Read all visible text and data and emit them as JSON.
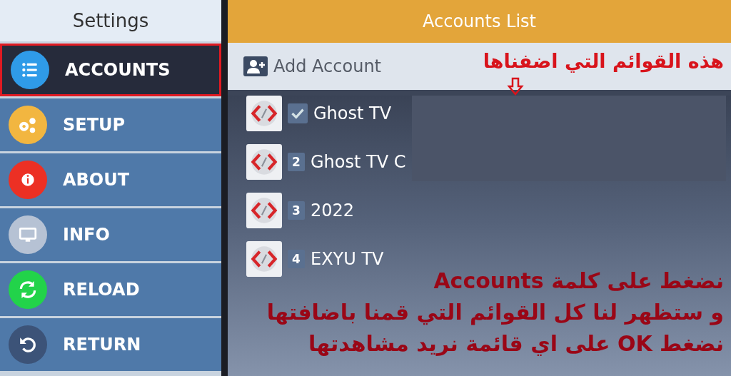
{
  "sidebar": {
    "title": "Settings",
    "items": [
      {
        "label": "ACCOUNTS",
        "selected": true,
        "color": "#2f9be8"
      },
      {
        "label": "SETUP",
        "selected": false,
        "color": "#f2b640"
      },
      {
        "label": "ABOUT",
        "selected": false,
        "color": "#ec3024"
      },
      {
        "label": "INFO",
        "selected": false,
        "color": "#b6c2d4"
      },
      {
        "label": "RELOAD",
        "selected": false,
        "color": "#22d34a"
      },
      {
        "label": "RETURN",
        "selected": false,
        "color": "#3c5378"
      }
    ]
  },
  "main": {
    "title": "Accounts List",
    "add_button": "Add Account",
    "accounts": [
      {
        "name": "Ghost TV",
        "active": true
      },
      {
        "name": "Ghost TV C",
        "active": false,
        "number": "2"
      },
      {
        "name": "2022",
        "active": false,
        "number": "3"
      },
      {
        "name": "EXYU TV",
        "active": false,
        "number": "4"
      }
    ]
  },
  "annotations": {
    "top": "هذه القوائم التي اضفناها",
    "bottom": [
      "نضغط على كلمة Accounts",
      "و ستظهر لنا كل القوائم التي قمنا باضافتها",
      "نضغط OK على اي قائمة نريد مشاهدتها"
    ]
  }
}
